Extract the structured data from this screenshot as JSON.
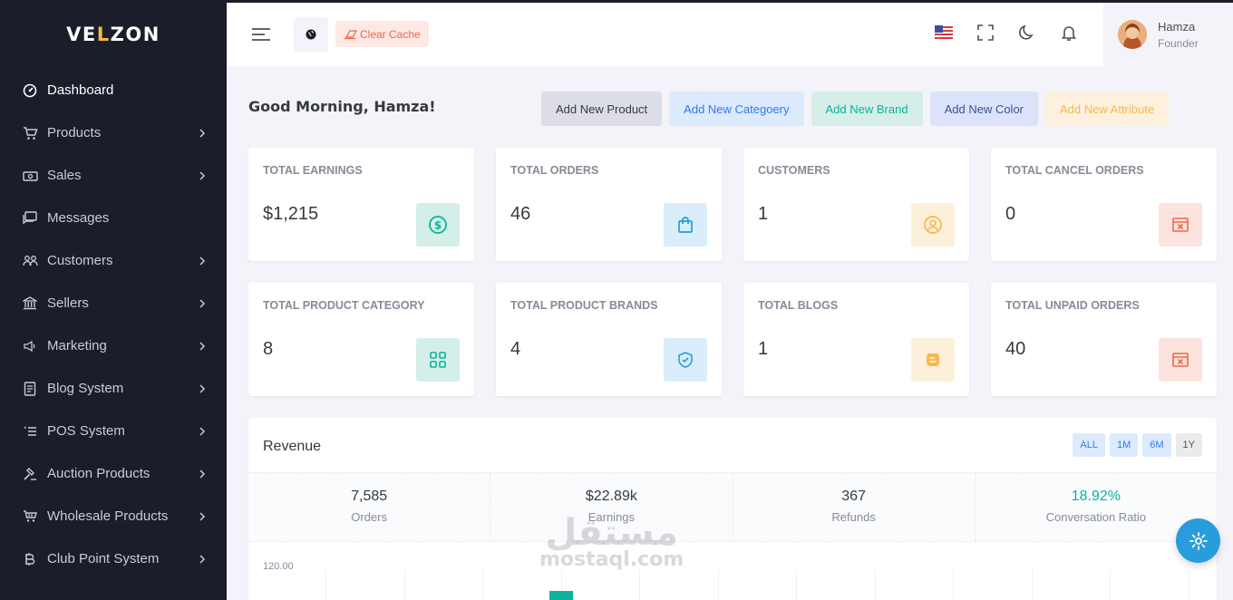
{
  "brand": {
    "name_pre": "VE",
    "name_dot": "L",
    "name_post": "ZON"
  },
  "sidebar": {
    "items": [
      {
        "label": "Dashboard",
        "icon": "dashboard-icon"
      },
      {
        "label": "Products",
        "icon": "cart-icon"
      },
      {
        "label": "Sales",
        "icon": "money-icon"
      },
      {
        "label": "Messages",
        "icon": "chat-icon"
      },
      {
        "label": "Customers",
        "icon": "users-icon"
      },
      {
        "label": "Sellers",
        "icon": "bank-icon"
      },
      {
        "label": "Marketing",
        "icon": "megaphone-icon"
      },
      {
        "label": "Blog System",
        "icon": "blog-icon"
      },
      {
        "label": "POS System",
        "icon": "list-icon"
      },
      {
        "label": "Auction Products",
        "icon": "gavel-icon"
      },
      {
        "label": "Wholesale Products",
        "icon": "shop-icon"
      },
      {
        "label": "Club Point System",
        "icon": "bitcoin-icon"
      }
    ]
  },
  "topbar": {
    "clear_cache": "Clear Cache",
    "user": {
      "name": "Hamza",
      "role": "Founder"
    }
  },
  "greeting": "Good Morning, Hamza!",
  "quick_actions": [
    "Add New Product",
    "Add New Categoery",
    "Add New Brand",
    "Add New Color",
    "Add New Attribute"
  ],
  "stats": [
    {
      "title": "TOTAL EARNINGS",
      "value": "$1,215",
      "icon": "dollar-icon",
      "color": "#0ab39c"
    },
    {
      "title": "TOTAL ORDERS",
      "value": "46",
      "icon": "bag-icon",
      "color": "#299cdb"
    },
    {
      "title": "CUSTOMERS",
      "value": "1",
      "icon": "user-circle-icon",
      "color": "#f7b84b"
    },
    {
      "title": "TOTAL CANCEL ORDERS",
      "value": "0",
      "icon": "cancel-icon",
      "color": "#f06548"
    },
    {
      "title": "TOTAL PRODUCT CATEGORY",
      "value": "8",
      "icon": "grid-icon",
      "color": "#0ab39c"
    },
    {
      "title": "TOTAL PRODUCT BRANDS",
      "value": "4",
      "icon": "shield-icon",
      "color": "#299cdb"
    },
    {
      "title": "TOTAL BLOGS",
      "value": "1",
      "icon": "blogger-icon",
      "color": "#f7b84b"
    },
    {
      "title": "TOTAL UNPAID ORDERS",
      "value": "40",
      "icon": "unpaid-icon",
      "color": "#f06548"
    }
  ],
  "revenue": {
    "title": "Revenue",
    "ranges": [
      "ALL",
      "1M",
      "6M",
      "1Y"
    ],
    "active_range": "1Y",
    "summary": [
      {
        "value": "7,585",
        "label": "Orders"
      },
      {
        "value": "$22.89k",
        "label": "Earnings"
      },
      {
        "value": "367",
        "label": "Refunds"
      },
      {
        "value": "18.92%",
        "label": "Conversation Ratio"
      }
    ],
    "y_top_label": "120.00"
  },
  "watermark": {
    "line1": "مستقل",
    "line2": "mostaql.com"
  }
}
